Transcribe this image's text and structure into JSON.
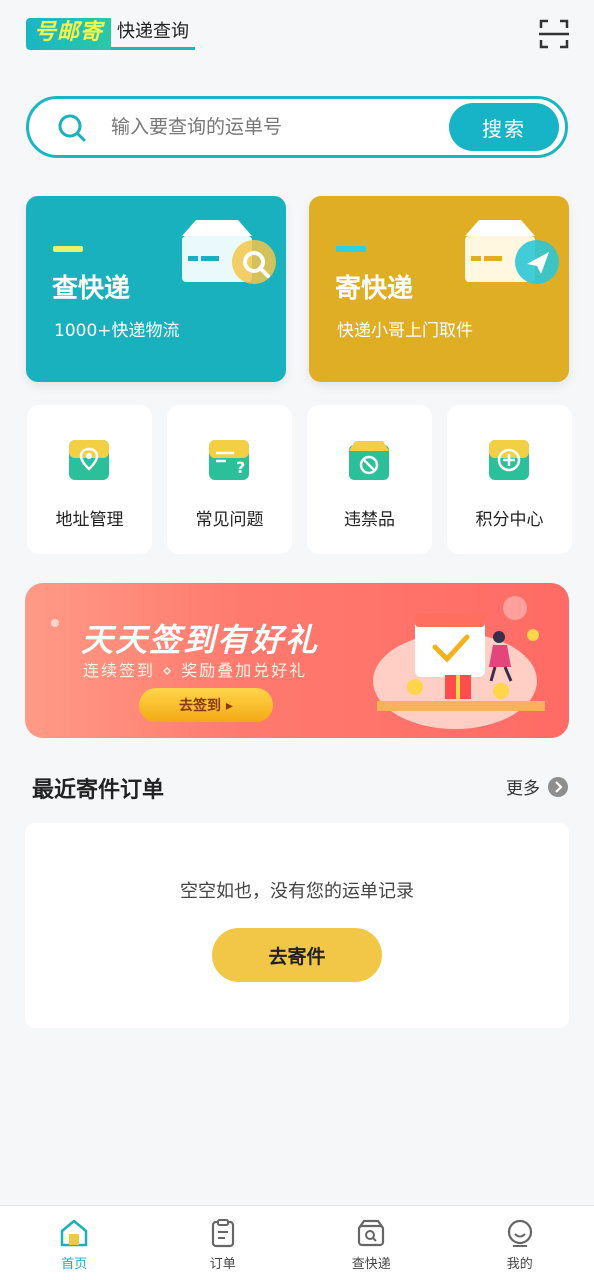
{
  "header": {
    "logo_text": "号邮寄",
    "logo_subtitle": "快递查询"
  },
  "search": {
    "placeholder": "输入要查询的运单号",
    "button_label": "搜索"
  },
  "cards": [
    {
      "title": "查快递",
      "subtitle": "1000+快递物流"
    },
    {
      "title": "寄快递",
      "subtitle": "快递小哥上门取件"
    }
  ],
  "quick_links": [
    {
      "label": "地址管理",
      "icon": "location-icon"
    },
    {
      "label": "常见问题",
      "icon": "question-icon"
    },
    {
      "label": "违禁品",
      "icon": "prohibited-icon"
    },
    {
      "label": "积分中心",
      "icon": "points-icon"
    }
  ],
  "banner": {
    "title": "天天签到有好礼",
    "subtitle": "连续签到 ⋄ 奖励叠加兑好礼",
    "button_label": "去签到 ▸"
  },
  "recent_orders": {
    "title": "最近寄件订单",
    "more_label": "更多",
    "empty_text": "空空如也，没有您的运单记录",
    "cta_label": "去寄件"
  },
  "tabbar": {
    "items": [
      {
        "label": "首页",
        "icon": "home-icon",
        "active": true
      },
      {
        "label": "订单",
        "icon": "order-icon",
        "active": false
      },
      {
        "label": "查快递",
        "icon": "track-icon",
        "active": false
      },
      {
        "label": "我的",
        "icon": "profile-icon",
        "active": false
      }
    ]
  },
  "colors": {
    "primary": "#18b1bd",
    "accent_yellow": "#dfae24",
    "cta_yellow": "#f2c646",
    "banner_red": "#ff6b66"
  }
}
